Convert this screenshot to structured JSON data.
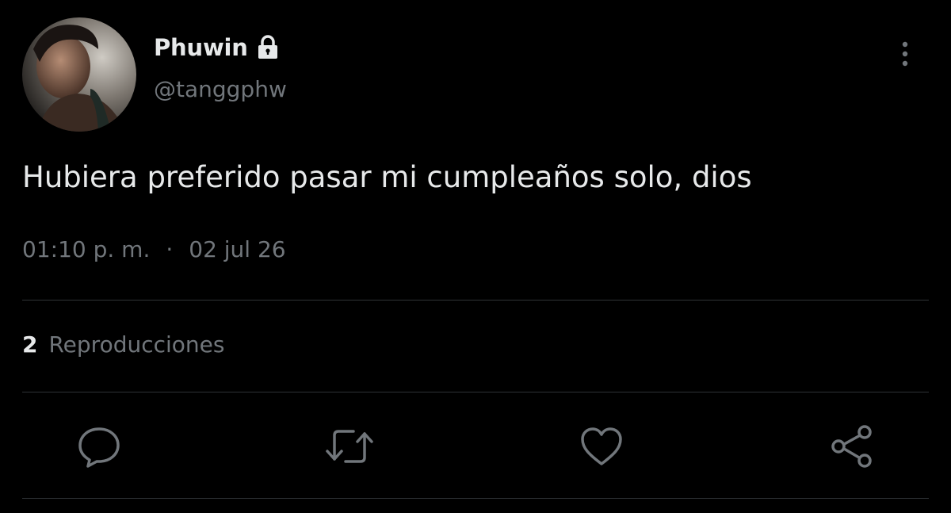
{
  "user": {
    "display_name": "Phuwin",
    "handle": "@tanggphw",
    "avatar_icon": "profile-photo",
    "protected_icon": "lock-icon"
  },
  "tweet": {
    "text": "Hubiera preferido pasar mi cumpleaños solo, dios",
    "time": "01:10 p. m.",
    "separator": "·",
    "date": "02 jul 26"
  },
  "stats": {
    "views_count": "2",
    "views_label": "Reproducciones"
  },
  "actions": [
    {
      "name": "reply",
      "icon": "speech-bubble-icon"
    },
    {
      "name": "retweet",
      "icon": "retweet-arrows-icon"
    },
    {
      "name": "like",
      "icon": "heart-icon"
    },
    {
      "name": "share",
      "icon": "share-nodes-icon"
    }
  ],
  "colors": {
    "background": "#000000",
    "primary_text": "#e7e9ea",
    "secondary_text": "#71767b",
    "divider": "#2f3336"
  }
}
